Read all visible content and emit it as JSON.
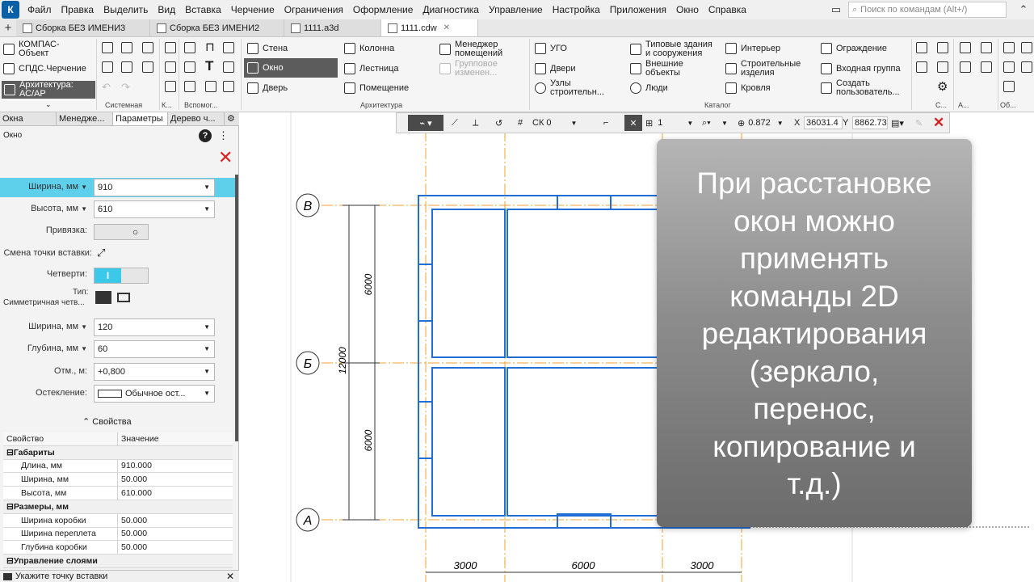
{
  "menu": {
    "items": [
      "Файл",
      "Правка",
      "Выделить",
      "Вид",
      "Вставка",
      "Черчение",
      "Ограничения",
      "Оформление",
      "Диагностика",
      "Управление",
      "Настройка",
      "Приложения",
      "Окно",
      "Справка"
    ],
    "search_placeholder": "Поиск по командам (Alt+/)"
  },
  "doc_tabs": [
    {
      "label": "Сборка БЕЗ ИМЕНИ3",
      "active": false
    },
    {
      "label": "Сборка БЕЗ ИМЕНИ2",
      "active": false
    },
    {
      "label": "1111.a3d",
      "active": false
    },
    {
      "label": "1111.cdw",
      "active": true
    }
  ],
  "ribbon": {
    "left_buttons": [
      "КОМПАС-Объект",
      "СПДС.Черчение",
      "Архитектура: АС/АР"
    ],
    "arch_buttons": [
      "Стена",
      "Окно",
      "Дверь",
      "Колонна",
      "Лестница",
      "Помещение",
      "Менеджер помещений",
      "Групповое изменен..."
    ],
    "catalog_buttons": [
      "УГО",
      "Двери",
      "Узлы строительн...",
      "Типовые здания и сооружения",
      "Внешние объекты",
      "Люди",
      "Интерьер",
      "Строительные изделия",
      "Кровля",
      "Ограждение",
      "Входная группа",
      "Создать пользователь..."
    ],
    "groups": [
      "Системная",
      "К...",
      "Вспомог...",
      "Архитектура",
      "Каталог",
      "С...",
      "А...",
      "Об..."
    ]
  },
  "left_tabs": [
    "Окна",
    "Менедже...",
    "Параметры",
    "Дерево ч..."
  ],
  "panel": {
    "title": "Окно",
    "width_label": "Ширина, мм",
    "width_value": "910",
    "height_label": "Высота, мм",
    "height_value": "610",
    "anchor_label": "Привязка:",
    "insert_point_label": "Смена точки вставки:",
    "quarters_label": "Четверти:",
    "type_label": "Тип:",
    "type_value": "Симметричная четв...",
    "q_width_label": "Ширина, мм",
    "q_width_value": "120",
    "q_depth_label": "Глубина, мм",
    "q_depth_value": "60",
    "elev_label": "Отм., м:",
    "elev_value": "+0,800",
    "glazing_label": "Остекление:",
    "glazing_value": "Обычное ост...",
    "props_header": "Свойства"
  },
  "prop_table": {
    "headers": [
      "Свойство",
      "Значение"
    ],
    "rows": [
      {
        "group": true,
        "name": "Габариты",
        "value": ""
      },
      {
        "group": false,
        "name": "Длина, мм",
        "value": "910.000"
      },
      {
        "group": false,
        "name": "Ширина, мм",
        "value": "50.000"
      },
      {
        "group": false,
        "name": "Высота, мм",
        "value": "610.000"
      },
      {
        "group": true,
        "name": "Размеры, мм",
        "value": ""
      },
      {
        "group": false,
        "name": "Ширина коробки",
        "value": "50.000"
      },
      {
        "group": false,
        "name": "Ширина переплета",
        "value": "50.000"
      },
      {
        "group": false,
        "name": "Глубина коробки",
        "value": "50.000"
      },
      {
        "group": true,
        "name": "Управление слоями",
        "value": ""
      }
    ]
  },
  "status": "Укажите точку вставки",
  "toolbar": {
    "cs": "СК 0",
    "layer": "1",
    "scale": "0.872",
    "x_label": "X",
    "x_value": "36031.4",
    "y_label": "Y",
    "y_value": "8862.73"
  },
  "drawing": {
    "axes": [
      "В",
      "Б",
      "А"
    ],
    "dims_vertical": [
      "6000",
      "6000",
      "12000"
    ],
    "dims_horizontal": [
      "3000",
      "6000",
      "3000"
    ]
  },
  "overlay_text": "При расстановке\nокон можно\nприменять\nкоманды 2D\nредактирования\n(зеркало,\nперенос,\nкопирование и\nт.д.)",
  "colors": {
    "wall": "#1f6fd6",
    "axis": "#f0a030",
    "accent": "#3cc8e8",
    "close": "#d92020"
  }
}
